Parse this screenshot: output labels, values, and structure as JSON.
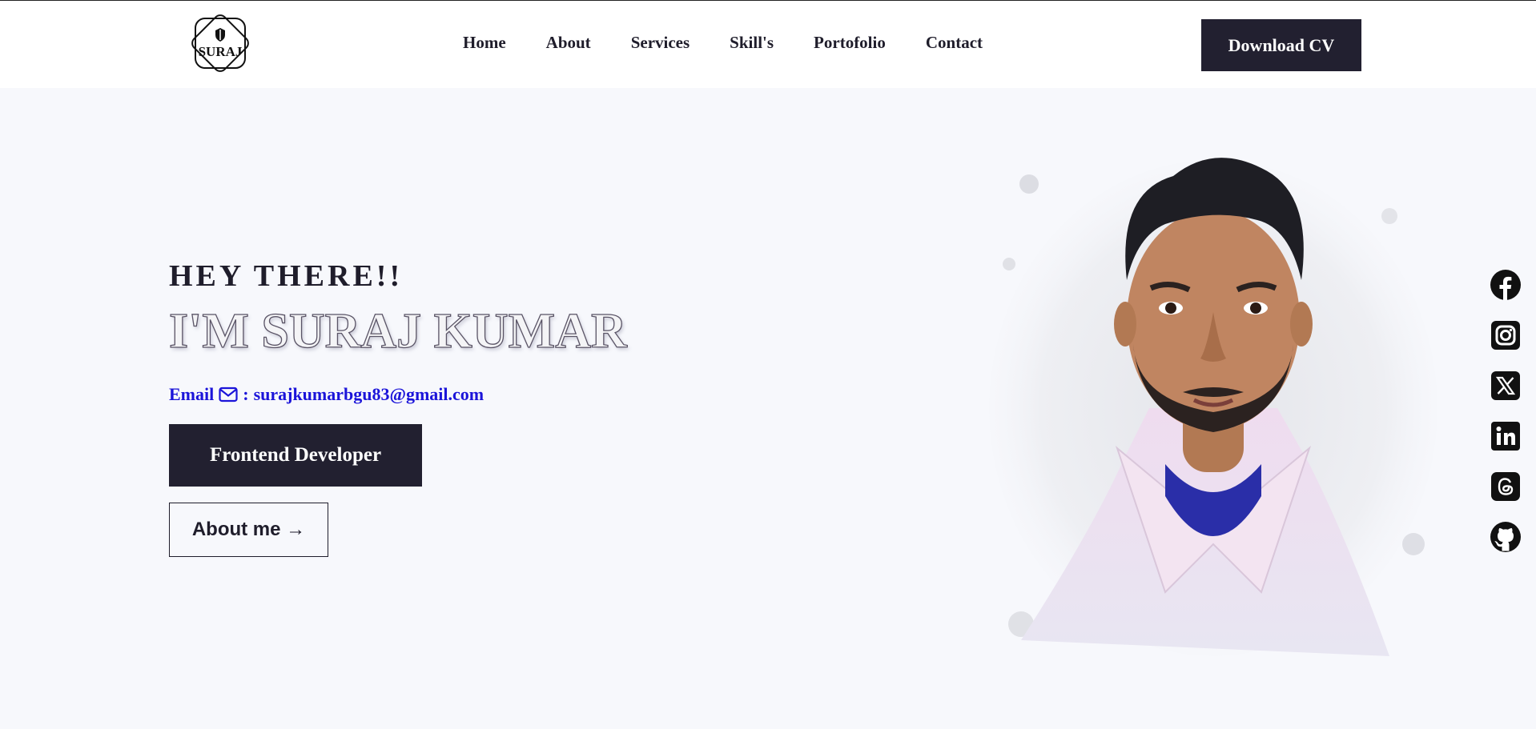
{
  "header": {
    "logo_text": "SURAJ",
    "nav": [
      "Home",
      "About",
      "Services",
      "Skill's",
      "Portofolio",
      "Contact"
    ],
    "download_label": "Download CV"
  },
  "hero": {
    "greeting": "HEY THERE!!",
    "name": "I'M SURAJ KUMAR",
    "email_label": "Email",
    "email_separator": ":",
    "email_value": "surajkumarbgu83@gmail.com",
    "role_label": "Frontend Developer",
    "about_label": "About me →"
  },
  "social": {
    "icons": [
      "facebook-icon",
      "instagram-icon",
      "x-icon",
      "linkedin-icon",
      "threads-icon",
      "github-icon"
    ]
  },
  "colors": {
    "dark": "#222030",
    "email_blue": "#1b14d9",
    "background": "#f7f8fc"
  }
}
